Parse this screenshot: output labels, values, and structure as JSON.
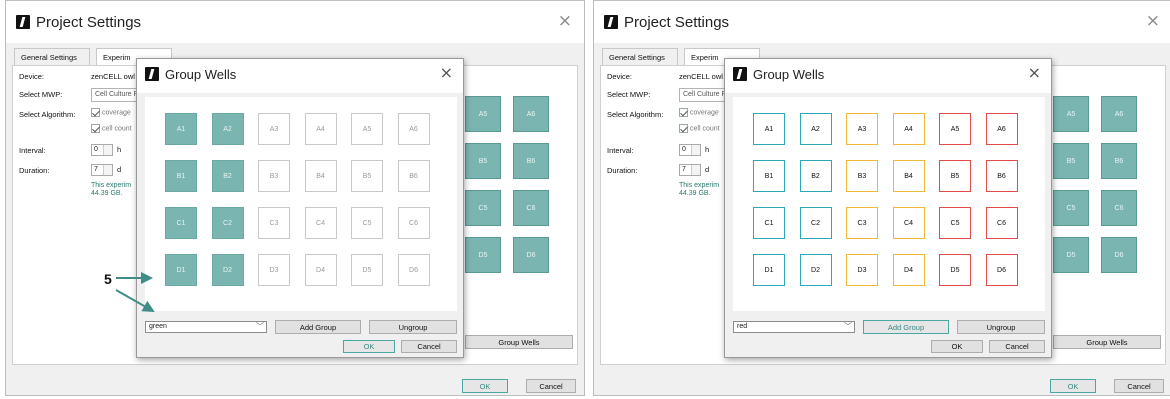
{
  "window": {
    "title": "Project Settings",
    "close": "×"
  },
  "tabs": [
    "General Settings",
    "Experiment Settings"
  ],
  "tab_visible_left": "Experim",
  "tab_visible_right": "e Settin",
  "form": {
    "device_label": "Device:",
    "device_value": "zenCELL owl",
    "mwp_label": "Select MWP:",
    "mwp_value": "Cell Culture P",
    "algo_label": "Select Algorithm:",
    "algo_opt1": "coverage",
    "algo_opt2": "cell count",
    "interval_label": "Interval:",
    "interval_value": "0",
    "interval_unit": "h",
    "duration_label": "Duration:",
    "duration_value": "7",
    "duration_unit": "d",
    "note_line1": "This experim",
    "note_line2": "44.39 GB."
  },
  "background_wells": [
    "A5",
    "A6",
    "B5",
    "B6",
    "C5",
    "C6",
    "D5",
    "D6"
  ],
  "group_wells_button": "Group Wells",
  "footer": {
    "ok": "OK",
    "cancel": "Cancel"
  },
  "dialog": {
    "title": "Group Wells",
    "close": "×",
    "add_group": "Add Group",
    "ungroup": "Ungroup",
    "ok": "OK",
    "cancel": "Cancel"
  },
  "wells": [
    [
      "A1",
      "A2",
      "A3",
      "A4",
      "A5",
      "A6"
    ],
    [
      "B1",
      "B2",
      "B3",
      "B4",
      "B5",
      "B6"
    ],
    [
      "C1",
      "C2",
      "C3",
      "C4",
      "C5",
      "C6"
    ],
    [
      "D1",
      "D2",
      "D3",
      "D4",
      "D5",
      "D6"
    ]
  ],
  "left_dialog": {
    "group_select": "green",
    "callout": "5"
  },
  "right_dialog": {
    "group_select": "red"
  },
  "colors": {
    "green": "#7ab5b1",
    "teal": "#2aa9b8",
    "yellow": "#f0b93a",
    "red": "#e34b4b"
  }
}
